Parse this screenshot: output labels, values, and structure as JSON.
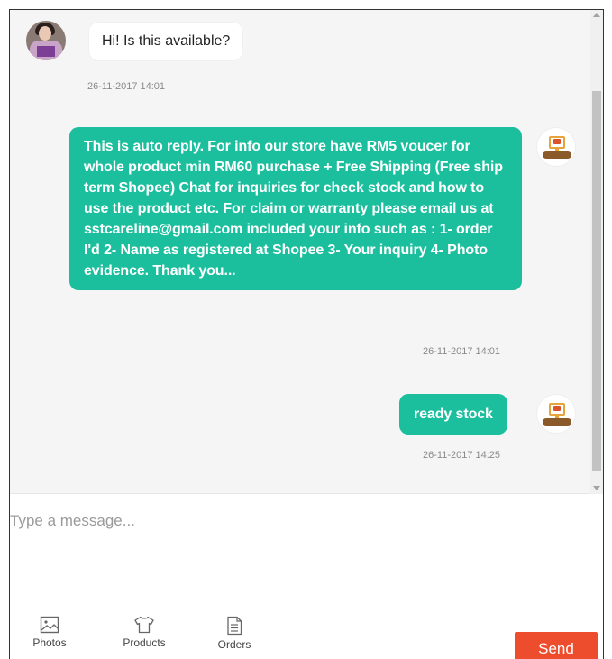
{
  "messages": [
    {
      "sender": "buyer",
      "text": "Hi! Is this available?",
      "timestamp": "26-11-2017 14:01"
    },
    {
      "sender": "seller",
      "text": "This is auto reply. For info our store have RM5 voucer for whole product min RM60 purchase + Free Shipping (Free ship term Shopee) Chat for inquiries for check stock and how to use the product etc. For claim or warranty please email us at sstcareline@gmail.com included your info such as : 1- order I'd 2- Name as registered at Shopee 3- Your inquiry 4- Photo evidence. Thank you...",
      "timestamp": "26-11-2017 14:01"
    },
    {
      "sender": "seller",
      "text": "ready stock",
      "timestamp": "26-11-2017 14:25"
    }
  ],
  "composer": {
    "placeholder": "Type a message...",
    "tools": [
      {
        "label": "Photos",
        "icon": "image-icon"
      },
      {
        "label": "Products",
        "icon": "tshirt-icon"
      },
      {
        "label": "Orders",
        "icon": "document-icon"
      }
    ],
    "send_label": "Send"
  },
  "colors": {
    "outgoing_bubble": "#1bbf9e",
    "send_button": "#ee4d2d",
    "background": "#f5f5f5"
  }
}
